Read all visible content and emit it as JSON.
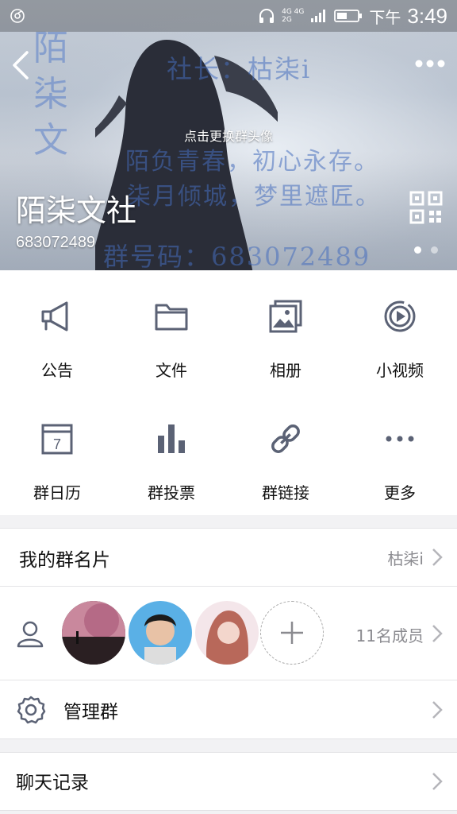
{
  "status_bar": {
    "network_top": "4G 4G",
    "network_bottom": "2G",
    "ampm": "下午",
    "time": "3:49"
  },
  "header": {
    "cover_texts": {
      "vertical": "陌柒文",
      "line1": "社长：枯柒i",
      "line2": "陌负青春，初心永存。",
      "line3": "柒月倾城，梦里遮匠。",
      "line4": "群号码：683072489"
    },
    "change_avatar_hint": "点击更换群头像",
    "group_name": "陌柒文社",
    "group_number": "683072489"
  },
  "features": [
    {
      "label": "公告",
      "icon": "megaphone-icon"
    },
    {
      "label": "文件",
      "icon": "folder-icon"
    },
    {
      "label": "相册",
      "icon": "photo-album-icon"
    },
    {
      "label": "小视频",
      "icon": "video-play-icon"
    },
    {
      "label": "群日历",
      "icon": "calendar-icon"
    },
    {
      "label": "群投票",
      "icon": "bar-chart-icon"
    },
    {
      "label": "群链接",
      "icon": "link-icon"
    },
    {
      "label": "更多",
      "icon": "ellipsis-icon"
    }
  ],
  "calendar_day": "7",
  "my_card": {
    "label": "我的群名片",
    "value": "枯柒i"
  },
  "members": {
    "count_label": "11名成员"
  },
  "manage": {
    "label": "管理群"
  },
  "history": {
    "label": "聊天记录"
  }
}
